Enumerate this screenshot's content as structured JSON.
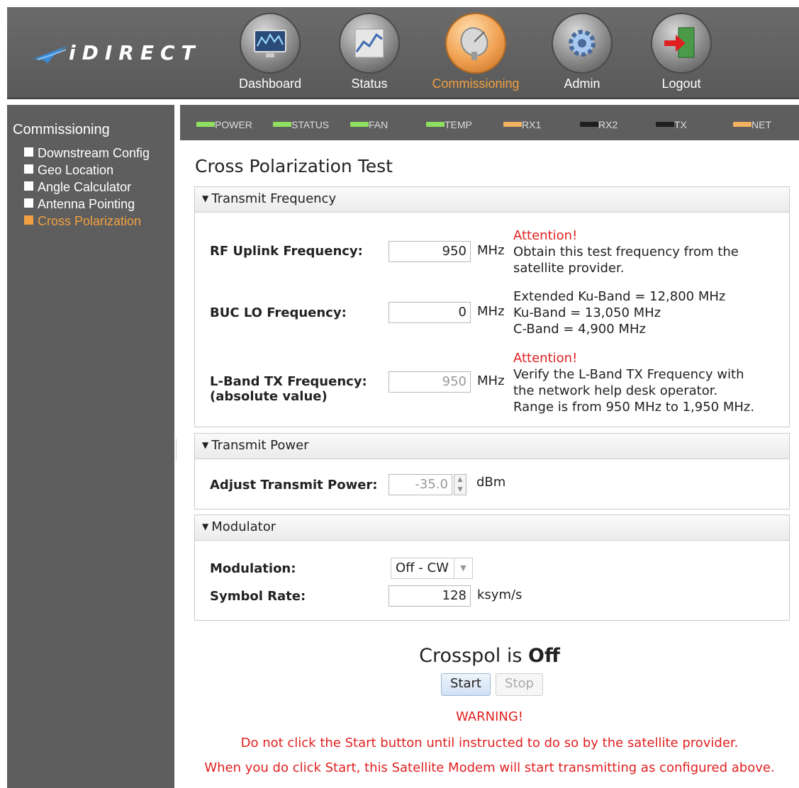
{
  "brand": {
    "logo_text": "iDIRECT"
  },
  "nav": {
    "items": [
      {
        "label": "Dashboard"
      },
      {
        "label": "Status"
      },
      {
        "label": "Commissioning"
      },
      {
        "label": "Admin"
      },
      {
        "label": "Logout"
      }
    ],
    "active": "Commissioning"
  },
  "sidebar": {
    "title": "Commissioning",
    "items": [
      {
        "label": "Downstream Config"
      },
      {
        "label": "Geo Location"
      },
      {
        "label": "Angle Calculator"
      },
      {
        "label": "Antenna Pointing"
      },
      {
        "label": "Cross Polarization"
      }
    ],
    "active": "Cross Polarization"
  },
  "leds": [
    {
      "label": "POWER",
      "color": "#8fe060"
    },
    {
      "label": "STATUS",
      "color": "#8fe060"
    },
    {
      "label": "FAN",
      "color": "#8fe060"
    },
    {
      "label": "TEMP",
      "color": "#8fe060"
    },
    {
      "label": "RX1",
      "color": "#f3b260"
    },
    {
      "label": "RX2",
      "color": "#1e1e1e"
    },
    {
      "label": "TX",
      "color": "#1e1e1e"
    },
    {
      "label": "NET",
      "color": "#f3b260"
    }
  ],
  "page": {
    "title": "Cross Polarization Test"
  },
  "transmit_frequency": {
    "header": "Transmit Frequency",
    "rf_uplink": {
      "label": "RF Uplink Frequency:",
      "value": "950",
      "unit": "MHz",
      "attention": "Attention!",
      "note_lines": [
        "Obtain this test frequency from the",
        "satellite provider."
      ]
    },
    "buc_lo": {
      "label": "BUC LO Frequency:",
      "value": "0",
      "unit": "MHz",
      "note_lines": [
        "Extended Ku-Band = 12,800 MHz",
        "Ku-Band = 13,050 MHz",
        "C-Band = 4,900 MHz"
      ]
    },
    "lband_tx": {
      "label_line1": "L-Band TX Frequency:",
      "label_line2": "(absolute value)",
      "value": "950",
      "unit": "MHz",
      "attention": "Attention!",
      "note_lines": [
        "Verify the L-Band TX Frequency with",
        "the network help desk operator.",
        "Range is from 950 MHz to 1,950 MHz."
      ]
    }
  },
  "transmit_power": {
    "header": "Transmit Power",
    "label": "Adjust Transmit Power:",
    "value": "-35.0",
    "unit": "dBm"
  },
  "modulator": {
    "header": "Modulator",
    "modulation_label": "Modulation:",
    "modulation_value": "Off - CW",
    "symbol_rate_label": "Symbol Rate:",
    "symbol_rate_value": "128",
    "symbol_rate_unit": "ksym/s"
  },
  "crosspol": {
    "status_prefix": "Crosspol is",
    "status_value": "Off",
    "start_label": "Start",
    "stop_label": "Stop",
    "warning_title": "WARNING!",
    "warning_line1": "Do not click the Start button until instructed to do so by the satellite provider.",
    "warning_line2": "When you do click Start, this Satellite Modem will start transmitting as configured above."
  }
}
